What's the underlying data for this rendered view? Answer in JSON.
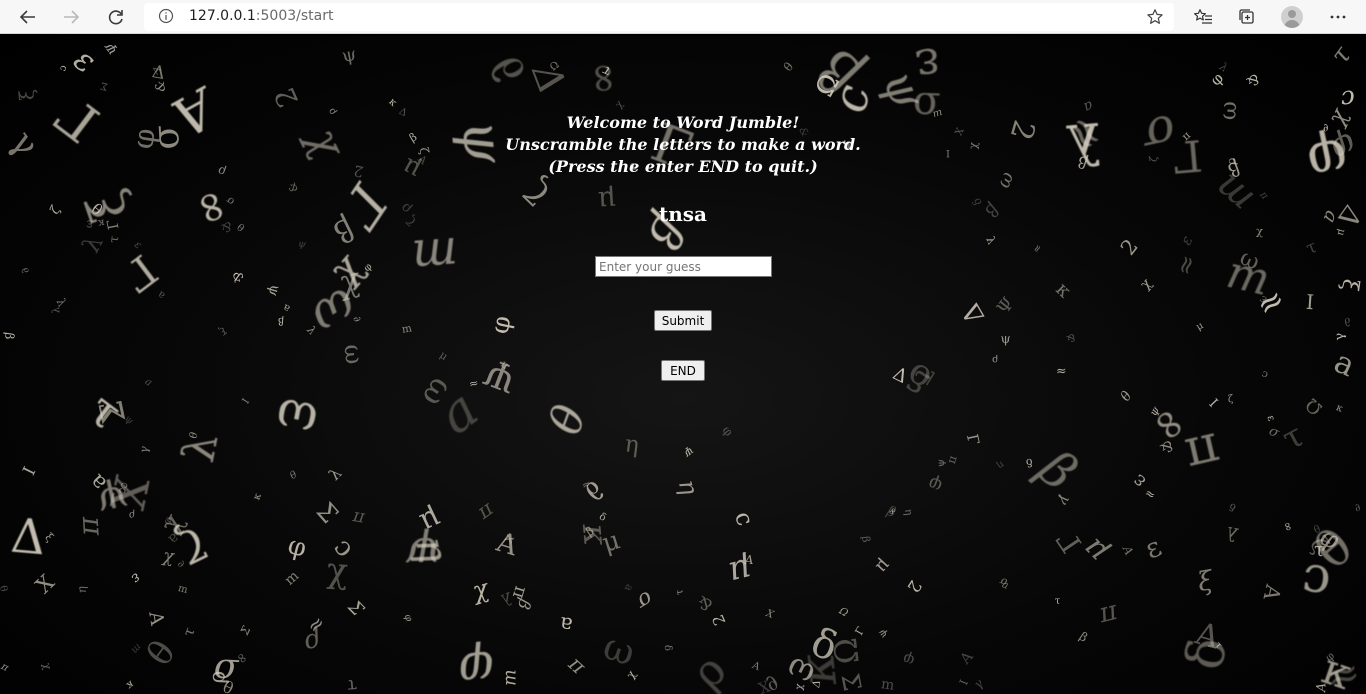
{
  "browser": {
    "url_host": "127.0.0.1",
    "url_rest": ":5003/start",
    "icons": {
      "back": "back-arrow-icon",
      "forward": "forward-arrow-icon",
      "refresh": "refresh-icon",
      "info": "info-icon",
      "favorite": "star-icon",
      "favorites_list": "favorites-icon",
      "collections": "collections-icon",
      "profile": "profile-avatar",
      "menu": "more-menu-icon"
    }
  },
  "game": {
    "welcome_lines": [
      "Welcome to Word Jumble!",
      "Unscramble the letters to make a word.",
      "(Press the enter END to quit.)"
    ],
    "scrambled_word": "tnsa",
    "guess_placeholder": "Enter your guess",
    "guess_value": "",
    "submit_label": "Submit",
    "end_label": "END"
  },
  "theme": {
    "background": "#000000",
    "text_color": "#ffffff",
    "glyph_color": "#d8d2c2"
  }
}
